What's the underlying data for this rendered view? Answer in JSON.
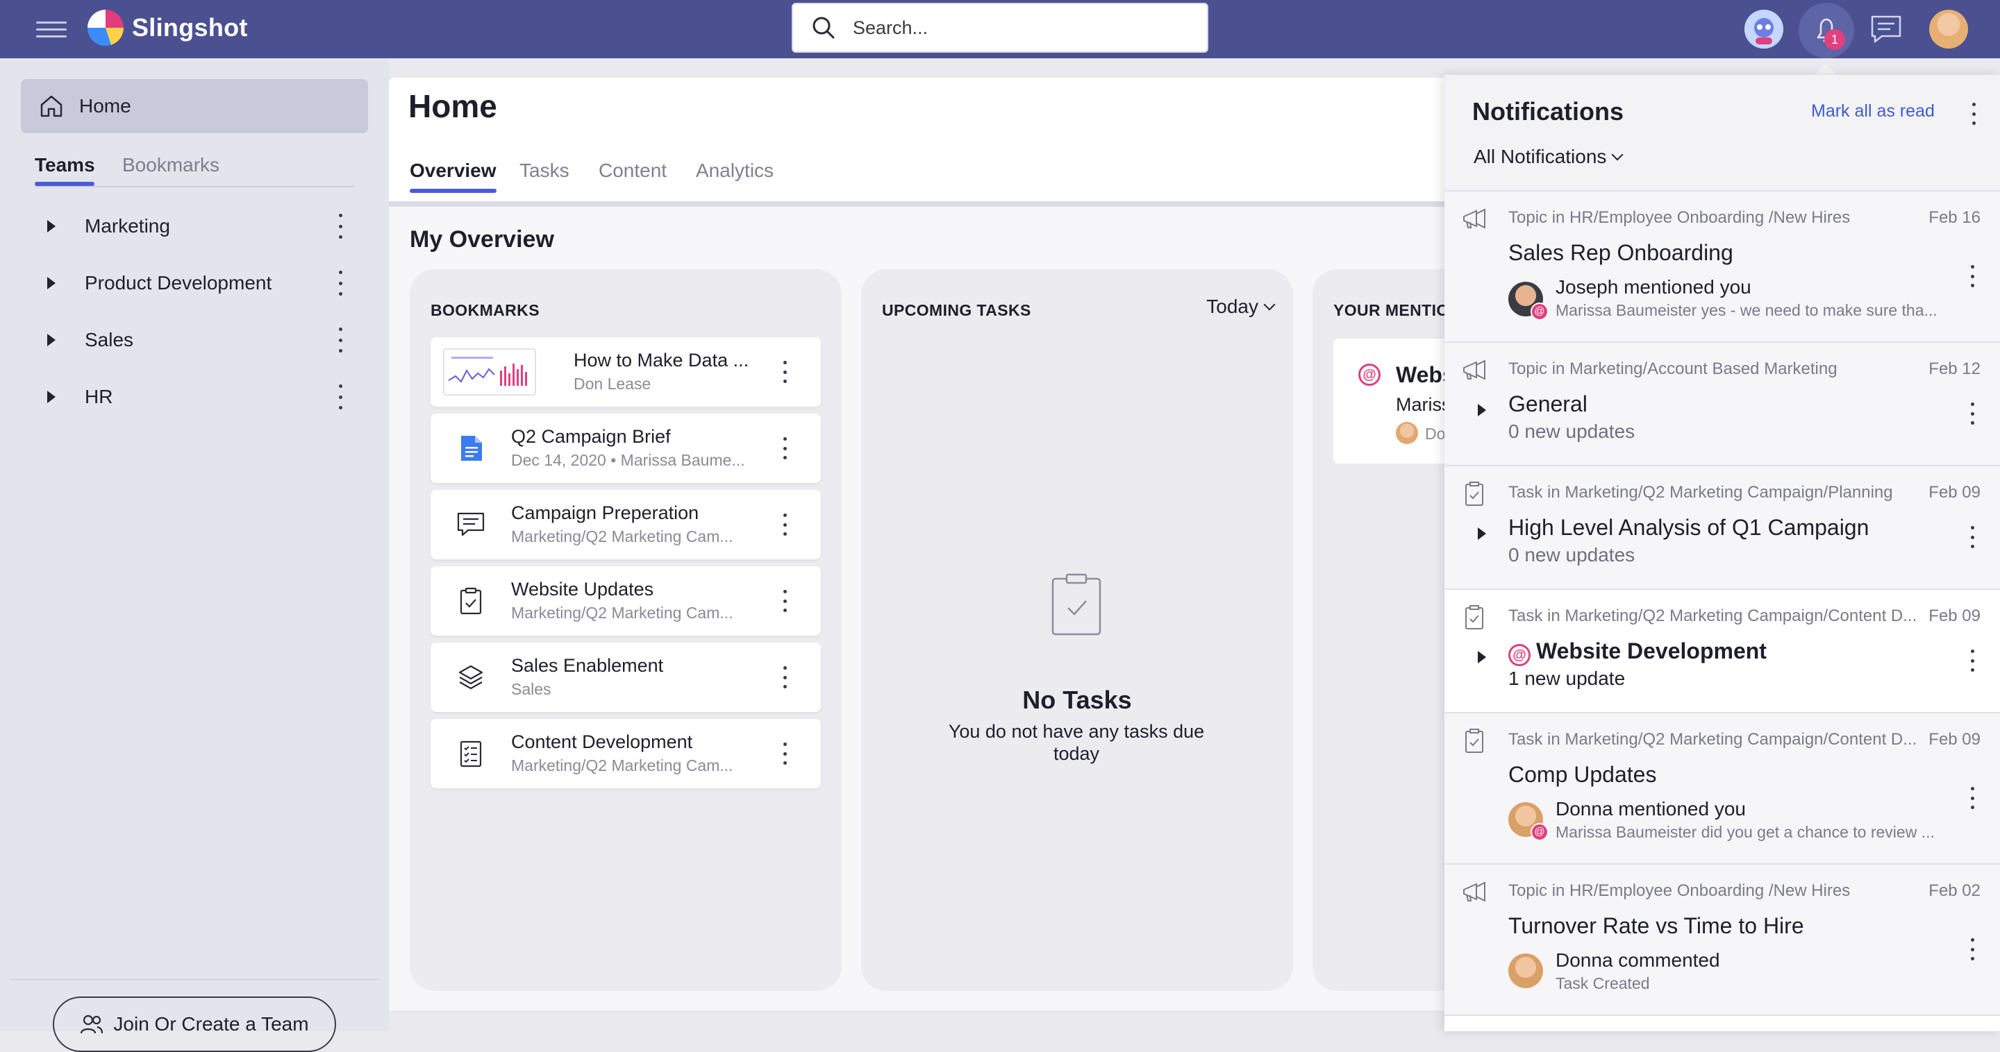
{
  "app": {
    "name": "Slingshot"
  },
  "topbar": {
    "search_placeholder": "Search...",
    "notification_count": "1"
  },
  "sidebar": {
    "home_label": "Home",
    "tabs": [
      {
        "label": "Teams"
      },
      {
        "label": "Bookmarks"
      }
    ],
    "teams": [
      {
        "label": "Marketing"
      },
      {
        "label": "Product Development"
      },
      {
        "label": "Sales"
      },
      {
        "label": "HR"
      }
    ],
    "join_button": "Join Or Create a Team"
  },
  "main": {
    "title": "Home",
    "tabs": [
      {
        "label": "Overview"
      },
      {
        "label": "Tasks"
      },
      {
        "label": "Content"
      },
      {
        "label": "Analytics"
      }
    ],
    "overview_title": "My Overview",
    "bookmarks": {
      "heading": "BOOKMARKS",
      "items": [
        {
          "title": "How to Make Data ...",
          "subtitle": "Don Lease",
          "icon": "chart-thumbnail"
        },
        {
          "title": "Q2 Campaign Brief",
          "subtitle": "Dec 14, 2020 • Marissa Baume...",
          "icon": "document-icon"
        },
        {
          "title": "Campaign Preperation",
          "subtitle": "Marketing/Q2 Marketing Cam...",
          "icon": "chat-icon"
        },
        {
          "title": "Website Updates",
          "subtitle": "Marketing/Q2 Marketing Cam...",
          "icon": "task-icon"
        },
        {
          "title": "Sales Enablement",
          "subtitle": "Sales",
          "icon": "layers-icon"
        },
        {
          "title": "Content Development",
          "subtitle": "Marketing/Q2 Marketing Cam...",
          "icon": "checklist-icon"
        }
      ]
    },
    "upcoming_tasks": {
      "heading": "UPCOMING TASKS",
      "filter": "Today",
      "empty_title": "No Tasks",
      "empty_text": "You do not have any tasks due today"
    },
    "mentions": {
      "heading": "YOUR MENTIONS",
      "card_title": "Website Development",
      "card_subtitle": "Marissa Baumeister",
      "card_meta": "Donna"
    }
  },
  "notifications": {
    "title": "Notifications",
    "mark_all": "Mark all as read",
    "filter": "All Notifications",
    "items": [
      {
        "context": "Topic in HR/Employee Onboarding /New Hires",
        "date": "Feb 16",
        "title": "Sales Rep Onboarding",
        "who": "Joseph mentioned you",
        "snippet": "Marissa Baumeister yes - we need to make sure tha...",
        "icon": "megaphone-icon"
      },
      {
        "context": "Topic in Marketing/Account Based Marketing",
        "date": "Feb 12",
        "title": "General",
        "updates": "0 new updates",
        "icon": "megaphone-icon"
      },
      {
        "context": "Task in Marketing/Q2 Marketing Campaign/Planning",
        "date": "Feb 09",
        "title": "High Level Analysis of Q1 Campaign",
        "updates": "0 new updates",
        "icon": "task-icon"
      },
      {
        "context": "Task in Marketing/Q2 Marketing Campaign/Content D...",
        "date": "Feb 09",
        "title": "Website Development",
        "updates": "1 new update",
        "icon": "task-icon"
      },
      {
        "context": "Task in Marketing/Q2 Marketing Campaign/Content D...",
        "date": "Feb 09",
        "title": "Comp Updates",
        "who": "Donna mentioned you",
        "snippet": "Marissa Baumeister did you get a chance to review ...",
        "icon": "task-icon"
      },
      {
        "context": "Topic in HR/Employee Onboarding /New Hires",
        "date": "Feb 02",
        "title": "Turnover Rate vs Time to Hire",
        "who": "Donna commented",
        "snippet": "Task Created",
        "icon": "megaphone-icon"
      }
    ]
  },
  "colors": {
    "topbar": "#4a5090",
    "accent": "#4a5cd6",
    "mention": "#e0407e",
    "link": "#3e5bd0"
  }
}
